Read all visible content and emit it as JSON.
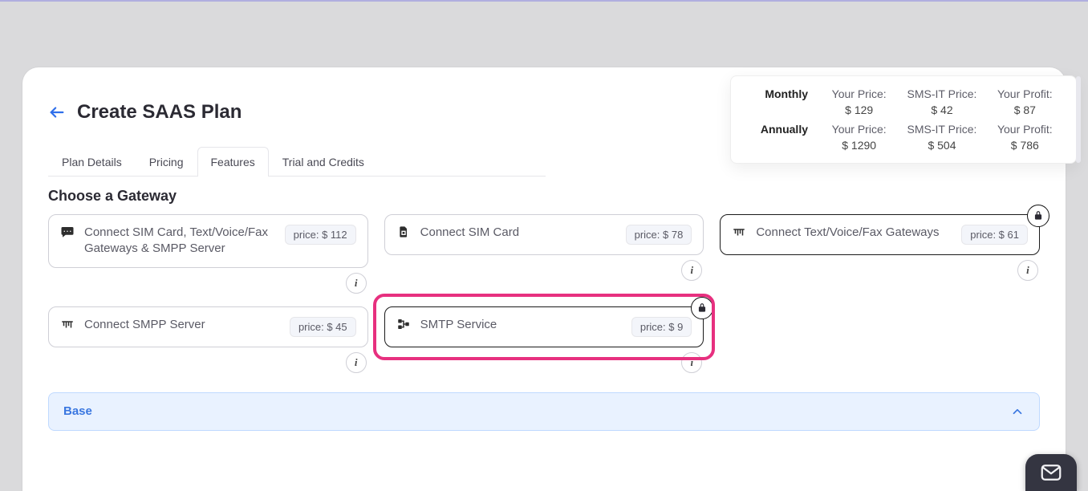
{
  "header": {
    "title": "Create SAAS Plan"
  },
  "tabs": [
    {
      "label": "Plan Details",
      "active": false
    },
    {
      "label": "Pricing",
      "active": false
    },
    {
      "label": "Features",
      "active": true
    },
    {
      "label": "Trial and Credits",
      "active": false
    }
  ],
  "pricing_summary": {
    "monthly": {
      "label": "Monthly",
      "your_price_label": "Your Price:",
      "your_price": "$ 129",
      "smsit_label": "SMS-IT Price:",
      "smsit_price": "$ 42",
      "profit_label": "Your Profit:",
      "profit": "$ 87"
    },
    "annually": {
      "label": "Annually",
      "your_price_label": "Your Price:",
      "your_price": "$ 1290",
      "smsit_label": "SMS-IT Price:",
      "smsit_price": "$ 504",
      "profit_label": "Your Profit:",
      "profit": "$ 786"
    }
  },
  "gateway_section": {
    "title": "Choose a Gateway",
    "price_prefix": "price: ",
    "items": [
      {
        "icon": "message",
        "title": "Connect SIM Card, Text/Voice/Fax Gateways & SMPP Server",
        "price": "$ 112",
        "selected": false,
        "locked": false
      },
      {
        "icon": "sim",
        "title": "Connect SIM Card",
        "price": "$ 78",
        "selected": false,
        "locked": false
      },
      {
        "icon": "gateway",
        "title": "Connect Text/Voice/Fax Gateways",
        "price": "$ 61",
        "selected": true,
        "locked": true
      },
      {
        "icon": "gateway",
        "title": "Connect SMPP Server",
        "price": "$ 45",
        "selected": false,
        "locked": false
      },
      {
        "icon": "smtp",
        "title": "SMTP Service",
        "price": "$ 9",
        "selected": true,
        "locked": true
      }
    ]
  },
  "accordion": {
    "base_label": "Base"
  }
}
